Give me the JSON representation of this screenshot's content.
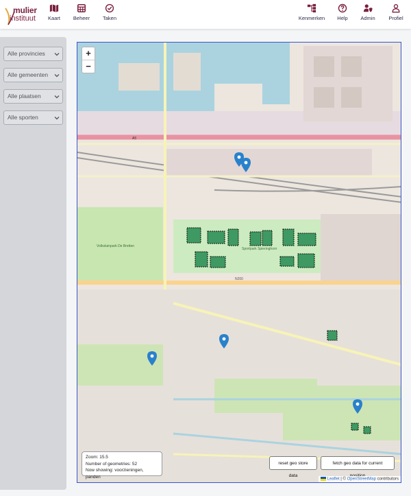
{
  "brand": {
    "line1": "mulier",
    "line2": "instituut"
  },
  "nav_left": [
    {
      "label": "Kaart",
      "icon": "map-icon"
    },
    {
      "label": "Beheer",
      "icon": "grid-icon"
    },
    {
      "label": "Taken",
      "icon": "check-circle-icon"
    }
  ],
  "nav_right": [
    {
      "label": "Kenmerken",
      "icon": "sitemap-icon"
    },
    {
      "label": "Help",
      "icon": "question-circle-icon"
    },
    {
      "label": "Admin",
      "icon": "user-shield-icon"
    },
    {
      "label": "Profiel",
      "icon": "user-icon"
    }
  ],
  "filters": [
    {
      "label": "Alle provincies"
    },
    {
      "label": "Alle gemeenten"
    },
    {
      "label": "Alle plaatsen"
    },
    {
      "label": "Alle sporten"
    }
  ],
  "map": {
    "zoom_in": "+",
    "zoom_out": "−",
    "info": {
      "zoom": "Zoom: 15.5",
      "count": "Number of geometries: 52",
      "showing": "Now showing: voorzieningen, panden"
    },
    "reset_button": "reset geo store data",
    "fetch_button": "fetch geo data for current position",
    "attribution_leaflet": "Leaflet",
    "attribution_sep": " | © ",
    "attribution_osm": "OpenStreetMap",
    "attribution_rest": " contributors",
    "labels": {
      "park": "Volkstuinpark De Bretten",
      "sport": "Sportpark Spieringhorn",
      "road1": "N200",
      "road2": "A5"
    }
  },
  "colors": {
    "brand": "#7a1f3d",
    "nav_text": "#2a2a4a",
    "map_border": "#3a55c8",
    "water": "#aad3df",
    "park": "#c8e6b0",
    "marker": "#2a81cb",
    "sport_field": "#3e9a62"
  }
}
